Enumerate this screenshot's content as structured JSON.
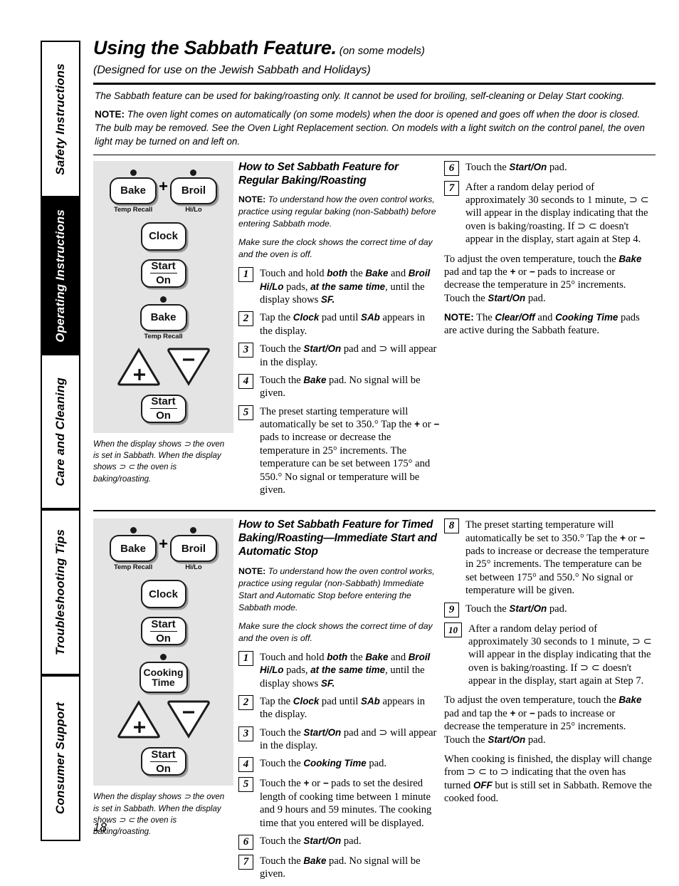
{
  "sidebar": {
    "tabs": [
      {
        "label": "Safety Instructions",
        "active": false
      },
      {
        "label": "Operating Instructions",
        "active": true
      },
      {
        "label": "Care and Cleaning",
        "active": false
      },
      {
        "label": "Troubleshooting Tips",
        "active": false
      },
      {
        "label": "Consumer Support",
        "active": false
      }
    ]
  },
  "header": {
    "title": "Using the Sabbath Feature.",
    "title_suffix": "(on some models)",
    "subtitle": "(Designed for use on the Jewish Sabbath and Holidays)"
  },
  "intro": {
    "line1": "The Sabbath feature can be used for baking/roasting only. It cannot be used for broiling, self-cleaning or Delay Start cooking.",
    "note_label": "NOTE:",
    "note_text": " The oven light comes on automatically (on some models) when the door is opened and goes off when the door is closed. The bulb may be removed. See the Oven Light Replacement section. On models with a light switch on the control panel, the oven light may be turned on and left on."
  },
  "keypad_caption": "When the display shows ⊃ the oven is set in Sabbath. When the display shows ⊃ ⊂ the oven is baking/roasting.",
  "keypad1": {
    "bake_label": "Bake",
    "bake_sub": "Temp Recall",
    "plus_sign": "+",
    "broil_label": "Broil",
    "broil_sub": "Hi/Lo",
    "clock_label": "Clock",
    "start_label": "Start",
    "on_label": "On",
    "bake2_label": "Bake",
    "bake2_sub": "Temp Recall",
    "plus_pad": "+",
    "minus_pad": "−",
    "start2_label": "Start",
    "on2_label": "On"
  },
  "keypad2": {
    "bake_label": "Bake",
    "bake_sub": "Temp Recall",
    "plus_sign": "+",
    "broil_label": "Broil",
    "broil_sub": "Hi/Lo",
    "clock_label": "Clock",
    "start_label": "Start",
    "on_label": "On",
    "cooking_label_1": "Cooking",
    "cooking_label_2": "Time",
    "plus_pad": "+",
    "minus_pad": "−",
    "start2_label": "Start",
    "on2_label": "On"
  },
  "section1": {
    "heading": "How to Set Sabbath Feature for Regular Baking/Roasting",
    "note_label": "NOTE:",
    "note_text": " To understand how the oven control works, practice using regular baking (non-Sabbath) before entering Sabbath mode.",
    "note2": "Make sure the clock shows the correct time of day and the oven is off.",
    "steps": [
      {
        "num": "1",
        "html": "Touch and hold <b>both</b> the <b>Bake</b> and <b>Broil Hi/Lo</b> pads, <b>at the same time</b>, until the display shows <b>SF.</b>"
      },
      {
        "num": "2",
        "html": "Tap the <b>Clock</b> pad until <b>SAb</b> appears in the display."
      },
      {
        "num": "3",
        "html": "Touch the <b>Start/On</b> pad and ⊃ will appear in the display."
      },
      {
        "num": "4",
        "html": "Touch the <b>Bake</b> pad. No signal will be given."
      },
      {
        "num": "5",
        "html": "The preset starting temperature will automatically be set to 350.° Tap the <b>+</b> or <b>−</b> pads to increase or decrease the temperature in 25° increments. The temperature can be set between 175° and 550.° No signal or temperature will be given."
      }
    ],
    "steps_right": [
      {
        "num": "6",
        "html": "Touch the <b>Start/On</b> pad."
      },
      {
        "num": "7",
        "html": "After a random delay period of approximately 30 seconds to 1 minute, ⊃ ⊂ will appear in the display indicating that the oven is baking/roasting. If ⊃ ⊂ doesn't appear in the display, start again at Step 4."
      }
    ],
    "para1": "To adjust the oven temperature, touch the <b>Bake</b> pad and tap the <b>+</b> or <b>−</b> pads to increase or decrease the temperature in 25° increments. Touch the <b>Start/On</b> pad.",
    "para2": "<span class=\"notelbl\">NOTE:</span> The <b>Clear/Off</b> and <b>Cooking Time</b> pads are active during the Sabbath feature."
  },
  "section2": {
    "heading": "How to Set Sabbath Feature for Timed Baking/Roasting—Immediate Start and Automatic Stop",
    "note_label": "NOTE:",
    "note_text": " To understand how the oven control works, practice using regular (non-Sabbath) Immediate Start and Automatic Stop before entering the Sabbath mode.",
    "note2": "Make sure the clock shows the correct time of day and the oven is off.",
    "steps": [
      {
        "num": "1",
        "html": "Touch and hold <b>both</b> the <b>Bake</b> and <b>Broil Hi/Lo</b> pads, <b>at the same time</b>, until the display shows <b>SF.</b>"
      },
      {
        "num": "2",
        "html": "Tap the <b>Clock</b> pad until <b>SAb</b> appears in the display."
      },
      {
        "num": "3",
        "html": "Touch the <b>Start/On</b> pad and ⊃ will appear in the display."
      },
      {
        "num": "4",
        "html": "Touch the <b>Cooking Time</b> pad."
      },
      {
        "num": "5",
        "html": "Touch the <b>+</b> or <b>−</b> pads to set the desired length of cooking time between 1 minute and 9 hours and 59 minutes. The cooking time that you entered will be displayed."
      },
      {
        "num": "6",
        "html": "Touch the <b>Start/On</b> pad."
      },
      {
        "num": "7",
        "html": "Touch the <b>Bake</b> pad. No signal will be given."
      }
    ],
    "steps_right": [
      {
        "num": "8",
        "html": "The preset starting temperature will automatically be set to 350.° Tap the <b>+</b> or <b>−</b> pads to increase or decrease the temperature in 25° increments. The temperature can be set between 175° and 550.° No signal or temperature will be given."
      },
      {
        "num": "9",
        "html": "Touch the <b>Start/On</b> pad."
      },
      {
        "num": "10",
        "html": "After a random delay period of approximately 30 seconds to 1 minute, ⊃ ⊂ will appear in the display indicating that the oven is baking/roasting. If ⊃ ⊂ doesn't appear in the display, start again at Step 7."
      }
    ],
    "para1": "To adjust the oven temperature, touch the <b>Bake</b> pad and tap the <b>+</b> or <b>−</b> pads to increase or decrease the temperature in 25° increments. Touch the <b>Start/On</b> pad.",
    "para2": "When cooking is finished, the display will change from ⊃ ⊂ to ⊃ indicating that the oven has turned <b>OFF</b> but is still set in Sabbath. Remove the cooked food."
  },
  "footer": {
    "page_number": "18"
  }
}
